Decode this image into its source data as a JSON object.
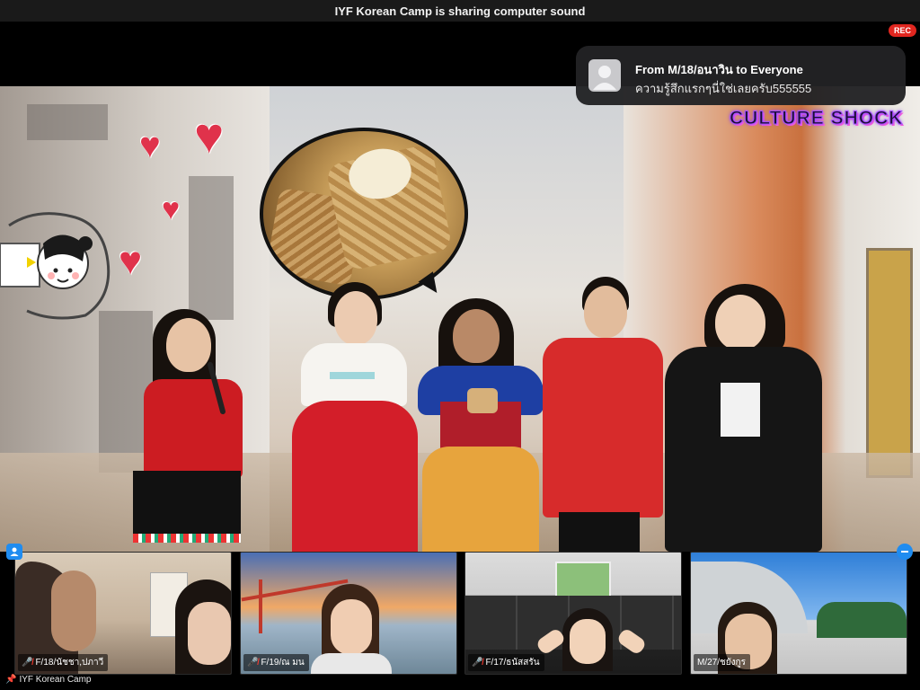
{
  "top_bar": {
    "sharing_text": "IYF Korean Camp is sharing computer sound"
  },
  "rec_badge": "REC",
  "notification": {
    "title": "From M/18/อนาวิน to Everyone",
    "message": "ความรู้สึกแรกๆนี่ใช่เลยครับ555555"
  },
  "overlay": {
    "title": "CULTURE SHOCK"
  },
  "participants": [
    {
      "name": "F/18/นัชชา,ปภาวี",
      "muted": true
    },
    {
      "name": "F/19/ณ มน",
      "muted": true
    },
    {
      "name": "F/17/ธนัสสรัน",
      "muted": true
    },
    {
      "name": "M/27/ชยังกูร",
      "muted": false
    }
  ],
  "host_label": "IYF Korean Camp",
  "colors": {
    "rec": "#e0261f",
    "accent": "#1f8cf0",
    "overlay_title": "#a24cff"
  },
  "icons": {
    "avatar": "person-avatar-icon",
    "mic_off": "mic-off-icon",
    "pin": "pin-icon",
    "gallery_left": "gallery-view-icon",
    "gallery_right": "minimize-icon"
  }
}
